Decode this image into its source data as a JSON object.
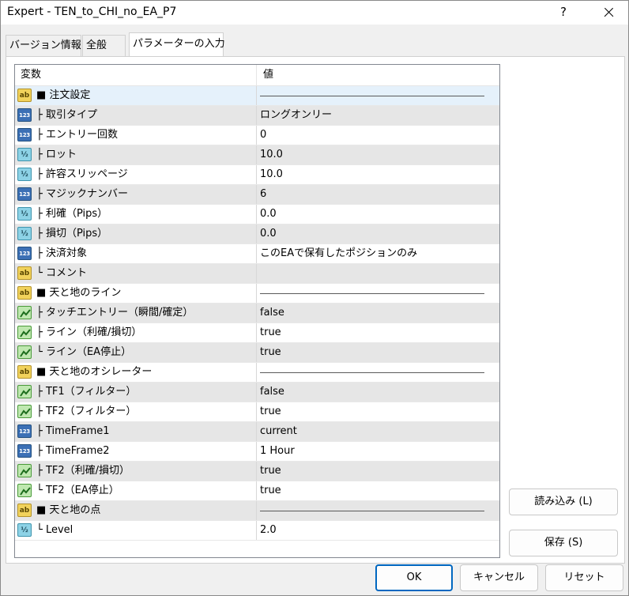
{
  "window": {
    "title": "Expert - TEN_to_CHI_no_EA_P7",
    "help_label": "?"
  },
  "tabs": [
    {
      "label": "バージョン情報"
    },
    {
      "label": "全般"
    },
    {
      "label": "パラメーターの入力"
    }
  ],
  "grid": {
    "col_name": "変数",
    "col_value": "値",
    "rows": [
      {
        "icon": "ab",
        "name": "■ 注文設定",
        "value": "",
        "separator": true
      },
      {
        "icon": "int",
        "name": "├ 取引タイプ",
        "value": "ロングオンリー"
      },
      {
        "icon": "int",
        "name": "├ エントリー回数",
        "value": "0"
      },
      {
        "icon": "dbl",
        "name": "├ ロット",
        "value": "10.0"
      },
      {
        "icon": "dbl",
        "name": "├ 許容スリッページ",
        "value": "10.0"
      },
      {
        "icon": "int",
        "name": "├ マジックナンバー",
        "value": "6"
      },
      {
        "icon": "dbl",
        "name": "├ 利確（Pips）",
        "value": "0.0"
      },
      {
        "icon": "dbl",
        "name": "├ 損切（Pips）",
        "value": "0.0"
      },
      {
        "icon": "int",
        "name": "├ 決済対象",
        "value": "このEAで保有したポジションのみ"
      },
      {
        "icon": "ab",
        "name": "└ コメント",
        "value": ""
      },
      {
        "icon": "ab",
        "name": "■ 天と地のライン",
        "value": "",
        "separator": true
      },
      {
        "icon": "bool",
        "name": "├ タッチエントリー（瞬間/確定）",
        "value": "false"
      },
      {
        "icon": "bool",
        "name": "├ ライン（利確/損切）",
        "value": "true"
      },
      {
        "icon": "bool",
        "name": "└ ライン（EA停止）",
        "value": "true"
      },
      {
        "icon": "ab",
        "name": "■ 天と地のオシレーター",
        "value": "",
        "separator": true
      },
      {
        "icon": "bool",
        "name": "├ TF1（フィルター）",
        "value": "false"
      },
      {
        "icon": "bool",
        "name": "├ TF2（フィルター）",
        "value": "true"
      },
      {
        "icon": "int",
        "name": "├ TimeFrame1",
        "value": "current"
      },
      {
        "icon": "int",
        "name": "├ TimeFrame2",
        "value": "1 Hour"
      },
      {
        "icon": "bool",
        "name": "├ TF2（利確/損切）",
        "value": "true"
      },
      {
        "icon": "bool",
        "name": "└ TF2（EA停止）",
        "value": "true"
      },
      {
        "icon": "ab",
        "name": "■ 天と地の点",
        "value": "",
        "separator": true
      },
      {
        "icon": "dbl",
        "name": "└ Level",
        "value": "2.0"
      }
    ]
  },
  "icon_labels": {
    "ab": "ab",
    "int": "123",
    "dbl": "½"
  },
  "buttons": {
    "load": "読み込み (L)",
    "save": "保存 (S)",
    "ok": "OK",
    "cancel": "キャンセル",
    "reset": "リセット"
  },
  "colors": {
    "selected_row": "#e5f1fb",
    "alt_row": "#e6e6e6",
    "ok_border": "#0067c0"
  }
}
